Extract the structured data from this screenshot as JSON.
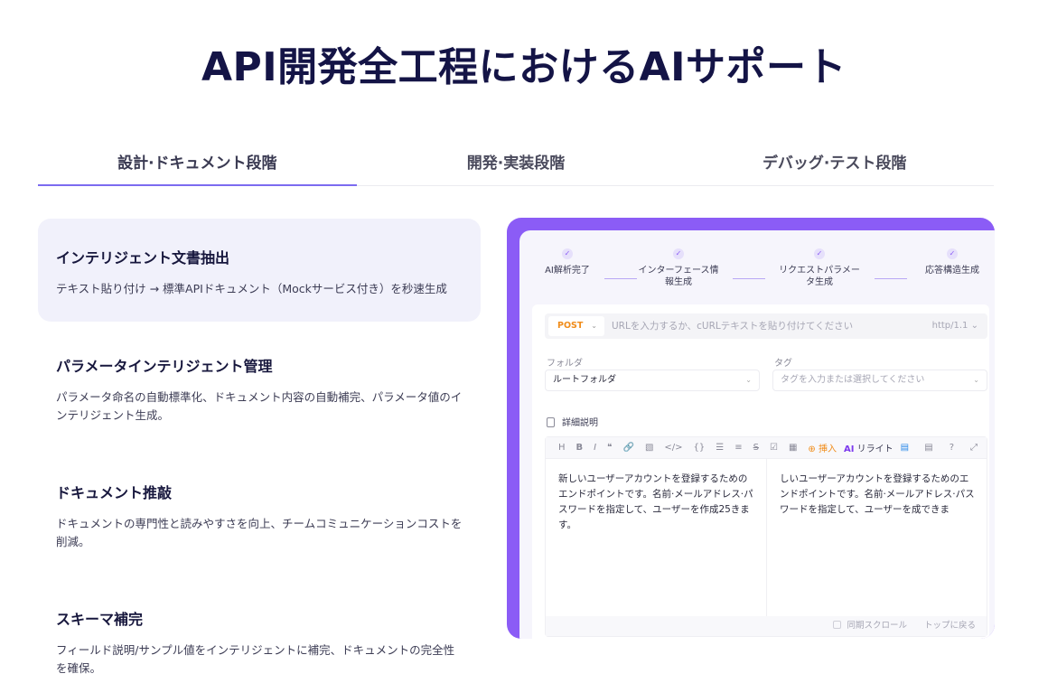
{
  "title": "API開発全工程におけるAIサポート",
  "tabs": [
    {
      "label": "設計·ドキュメント段階"
    },
    {
      "label": "開発·実装段階"
    },
    {
      "label": "デバッグ·テスト段階"
    }
  ],
  "features": [
    {
      "title": "インテリジェント文書抽出",
      "desc": "テキスト貼り付け → 標準APIドキュメント（Mockサービス付き）を秒速生成"
    },
    {
      "title": "パラメータインテリジェント管理",
      "desc": "パラメータ命名の自動標準化、ドキュメント内容の自動補完、パラメータ値のインテリジェント生成。"
    },
    {
      "title": "ドキュメント推敲",
      "desc": "ドキュメントの専門性と読みやすさを向上、チームコミュニケーションコストを削減。"
    },
    {
      "title": "スキーマ補完",
      "desc": "フィールド説明/サンプル値をインテリジェントに補完、ドキュメントの完全性を確保。"
    }
  ],
  "mock": {
    "steps": [
      {
        "label": "AI解析完了"
      },
      {
        "label": "インターフェース情報生成"
      },
      {
        "label": "リクエストパラメータ生成"
      },
      {
        "label": "応答構造生成"
      }
    ],
    "check_glyph": "✓",
    "method": "POST",
    "url_placeholder": "URLを入力するか、cURLテキストを貼り付けてください",
    "http_version": "http/1.1",
    "folder_label": "フォルダ",
    "folder_value": "ルートフォルダ",
    "tag_label": "タグ",
    "tag_placeholder": "タグを入力または選択してください",
    "desc_label": "詳細説明",
    "toolbar": {
      "heading": "H",
      "bold": "B",
      "italic": "I",
      "quote": "❝",
      "link": "🔗",
      "image": "▧",
      "code": "</>",
      "braces": "{}",
      "ul": "☰",
      "ol": "≡",
      "strike": "S",
      "task": "☑",
      "table": "▦",
      "insert": "挿入",
      "ai_mark": "AI",
      "ai_label": "リライト",
      "doc": "▤",
      "help": "?",
      "expand": "⤢"
    },
    "left_text": "新しいユーザーアカウントを登録するためのエンドポイントです。名前·メールアドレス·パスワードを指定して、ユーザーを作成25きます。",
    "right_text": "しいユーザーアカウントを登録するためのエンドポイントです。名前·メールアドレス·パスワードを指定して、ユーザーを成できま",
    "sync_scroll": "同期スクロール",
    "back_to_top": "トップに戻る"
  }
}
